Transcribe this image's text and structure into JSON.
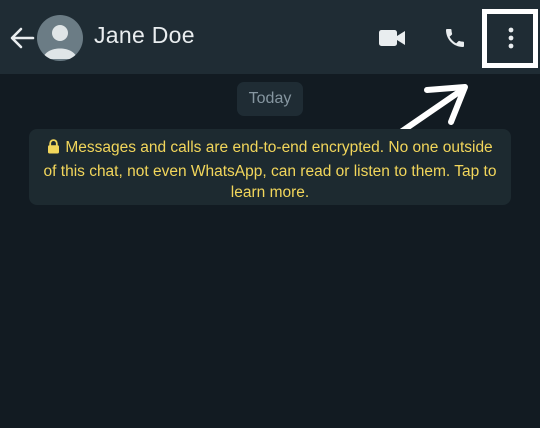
{
  "header": {
    "contact_name": "Jane Doe",
    "back_icon": "arrow-left-icon",
    "avatar_icon": "default-avatar-icon",
    "video_icon": "video-camera-icon",
    "call_icon": "phone-icon",
    "menu_icon": "more-vertical-icon"
  },
  "chat": {
    "date_label": "Today",
    "encryption_notice": "Messages and calls are end-to-end encrypted. No one outside of this chat, not even WhatsApp, can read or listen to them. Tap to learn more.",
    "lock_icon": "lock-icon"
  },
  "colors": {
    "background": "#121b22",
    "header": "#1f2c34",
    "notice_text": "#f2d65b",
    "annotation": "#ffffff"
  }
}
